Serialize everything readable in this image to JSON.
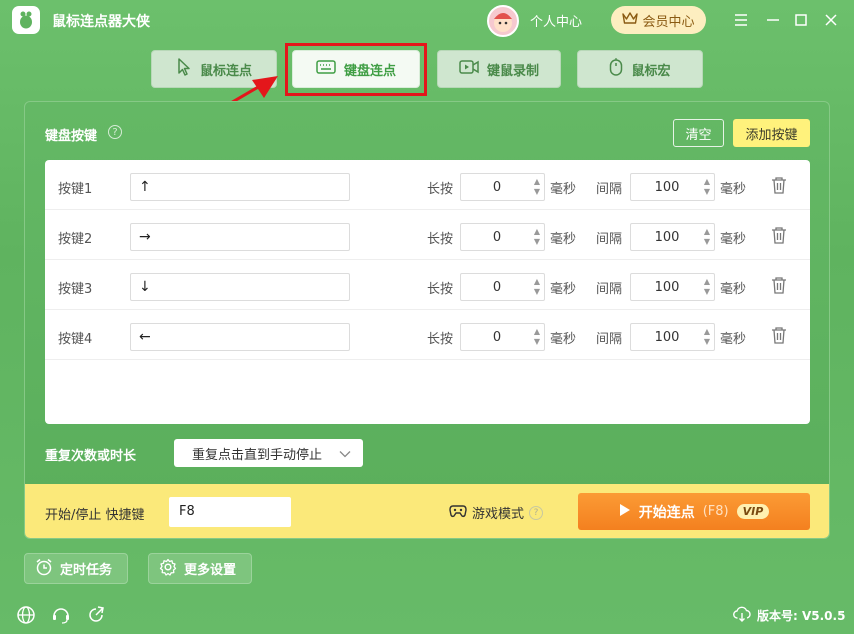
{
  "app": {
    "title": "鼠标连点器大侠"
  },
  "header": {
    "personal_center": "个人中心",
    "vip_center": "会员中心"
  },
  "tabs": [
    {
      "label": "鼠标连点",
      "icon": "cursor-icon",
      "active": false
    },
    {
      "label": "键盘连点",
      "icon": "keyboard-icon",
      "active": true
    },
    {
      "label": "键鼠录制",
      "icon": "video-icon",
      "active": false
    },
    {
      "label": "鼠标宏",
      "icon": "mouse-icon",
      "active": false
    }
  ],
  "panel": {
    "title": "键盘按键",
    "help": "?",
    "clear_label": "清空",
    "add_label": "添加按键"
  },
  "rows": [
    {
      "label": "按键1",
      "key": "↑",
      "hold_label": "长按",
      "hold": "0",
      "hold_unit": "毫秒",
      "interval_label": "间隔",
      "interval": "100",
      "interval_unit": "毫秒"
    },
    {
      "label": "按键2",
      "key": "→",
      "hold_label": "长按",
      "hold": "0",
      "hold_unit": "毫秒",
      "interval_label": "间隔",
      "interval": "100",
      "interval_unit": "毫秒"
    },
    {
      "label": "按键3",
      "key": "↓",
      "hold_label": "长按",
      "hold": "0",
      "hold_unit": "毫秒",
      "interval_label": "间隔",
      "interval": "100",
      "interval_unit": "毫秒"
    },
    {
      "label": "按键4",
      "key": "←",
      "hold_label": "长按",
      "hold": "0",
      "hold_unit": "毫秒",
      "interval_label": "间隔",
      "interval": "100",
      "interval_unit": "毫秒"
    }
  ],
  "repeat": {
    "label": "重复次数或时长",
    "value": "重复点击直到手动停止"
  },
  "hotkey": {
    "label": "开始/停止 快捷键",
    "value": "F8"
  },
  "game_mode": {
    "label": "游戏模式"
  },
  "start": {
    "label": "开始连点",
    "shortcut": "(F8)",
    "badge": "VIP"
  },
  "footer": {
    "scheduled_label": "定时任务",
    "settings_label": "更多设置",
    "version_label": "版本号: V5.0.5"
  },
  "colors": {
    "accent_green": "#5fb35f",
    "start_orange": "#f6871f",
    "highlight_red": "#e4161b",
    "vip_yellow": "#fbe97a"
  }
}
